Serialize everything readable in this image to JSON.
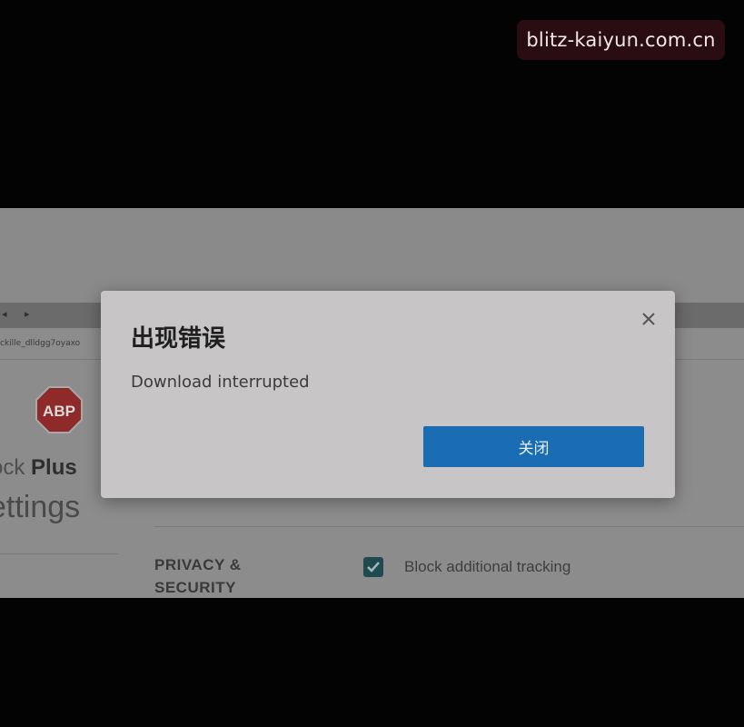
{
  "watermark": {
    "text": "blitz-kaiyun.com.cn"
  },
  "background_page": {
    "browser_arrows": "◂ ▸",
    "url": "ckille_dlldgg7oyaxo",
    "logo_text": "ABP",
    "brand_light": "ock ",
    "brand_bold": "Plus",
    "settings_title": "ettings",
    "section_heading": "PRIVACY & SECURITY",
    "checkbox_label": "Block additional tracking",
    "checkbox_checked": true
  },
  "dialog": {
    "title": "出现错误",
    "message": "Download interrupted",
    "primary_button": "关闭",
    "close_icon": "close-icon"
  },
  "colors": {
    "dialog_bg": "#c7c5c5",
    "primary": "#1a6cb3",
    "logo_red": "#b01a1a"
  }
}
